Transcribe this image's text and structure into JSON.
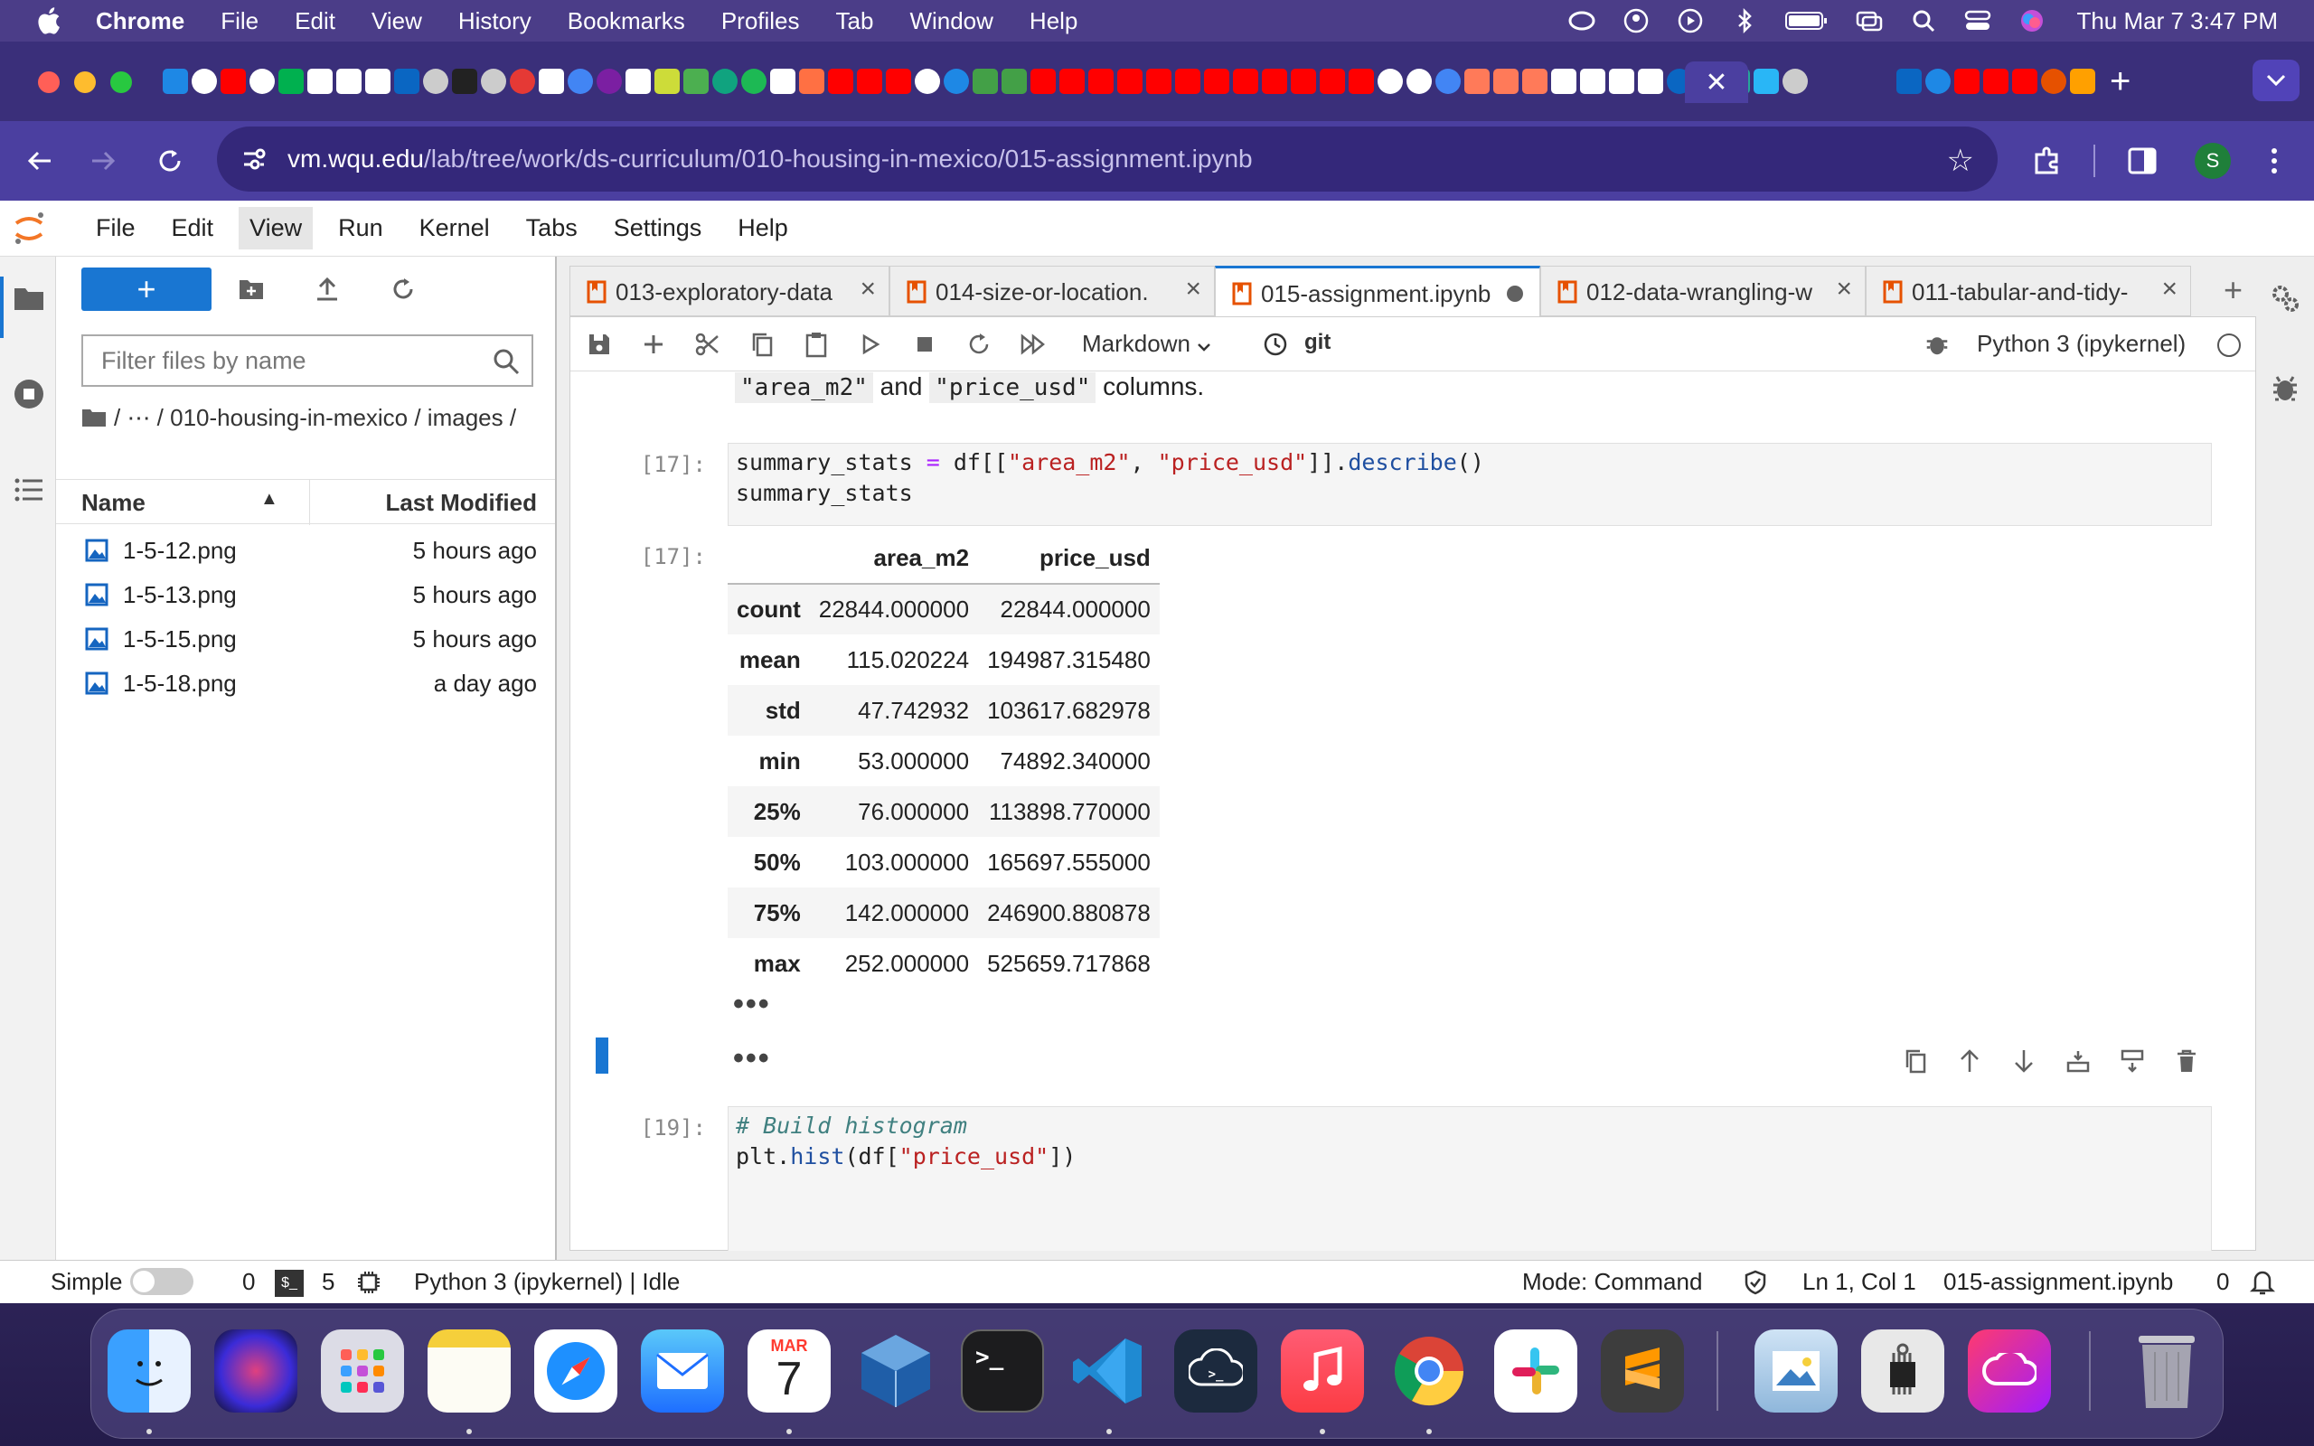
{
  "macos_menubar": {
    "app_name": "Chrome",
    "items": [
      "File",
      "Edit",
      "View",
      "History",
      "Bookmarks",
      "Profiles",
      "Tab",
      "Window",
      "Help"
    ],
    "clock": "Thu Mar 7  3:47 PM",
    "status_icons": [
      "creative-cloud-icon",
      "user-circle-icon",
      "play-circle-icon",
      "bluetooth-icon",
      "battery-icon",
      "screen-mirror-icon",
      "search-icon",
      "control-center-icon",
      "siri-icon"
    ]
  },
  "chrome": {
    "active_tab_close": "✕",
    "new_tab": "+",
    "url_host": "vm.wqu.edu",
    "url_path": "/lab/tree/work/ds-curriculum/010-housing-in-mexico/015-assignment.ipynb",
    "profile_initial": "S"
  },
  "jupyter_menu": [
    "File",
    "Edit",
    "View",
    "Run",
    "Kernel",
    "Tabs",
    "Settings",
    "Help"
  ],
  "filebrowser": {
    "new_button": "+",
    "filter_placeholder": "Filter files by name",
    "breadcrumb": "/ ⋯ / 010-housing-in-mexico / images /",
    "col_name": "Name",
    "col_modified": "Last Modified",
    "files": [
      {
        "name": "1-5-12.png",
        "modified": "5 hours ago"
      },
      {
        "name": "1-5-13.png",
        "modified": "5 hours ago"
      },
      {
        "name": "1-5-15.png",
        "modified": "5 hours ago"
      },
      {
        "name": "1-5-18.png",
        "modified": "a day ago"
      }
    ]
  },
  "doc_tabs": [
    {
      "label": "013-exploratory-data",
      "active": false
    },
    {
      "label": "014-size-or-location.",
      "active": false
    },
    {
      "label": "015-assignment.ipynb",
      "active": true
    },
    {
      "label": "012-data-wrangling-w",
      "active": false
    },
    {
      "label": "011-tabular-and-tidy-",
      "active": false
    }
  ],
  "notebook_toolbar": {
    "cell_type": "Markdown",
    "git": "git",
    "kernel": "Python 3 (ipykernel)"
  },
  "cells": {
    "markdown_tail": {
      "code1": "\"area_m2\"",
      "and": "and",
      "code2": "\"price_usd\"",
      "rest": "columns."
    },
    "cell17_prompt": "[17]:",
    "cell17_code": {
      "line1_var": "summary_stats",
      "line1_eq": " = ",
      "line1_df": "df[[",
      "line1_s1": "\"area_m2\"",
      "line1_comma": ", ",
      "line1_s2": "\"price_usd\"",
      "line1_close": "]].",
      "line1_fn": "describe",
      "line1_end": "()",
      "line2": "summary_stats"
    },
    "out17_prompt": "[17]:",
    "table_header": [
      "",
      "area_m2",
      "price_usd"
    ],
    "table_rows": [
      [
        "count",
        "22844.000000",
        "22844.000000"
      ],
      [
        "mean",
        "115.020224",
        "194987.315480"
      ],
      [
        "std",
        "47.742932",
        "103617.682978"
      ],
      [
        "min",
        "53.000000",
        "74892.340000"
      ],
      [
        "25%",
        "76.000000",
        "113898.770000"
      ],
      [
        "50%",
        "103.000000",
        "165697.555000"
      ],
      [
        "75%",
        "142.000000",
        "246900.880878"
      ],
      [
        "max",
        "252.000000",
        "525659.717868"
      ]
    ],
    "ellipsis": "•••",
    "cell19_prompt": "[19]:",
    "cell19_comment": "# Build histogram",
    "cell19_pre": "plt.",
    "cell19_fn": "hist",
    "cell19_mid": "(df[",
    "cell19_str": "\"price_usd\"",
    "cell19_end": "])"
  },
  "statusbar": {
    "simple": "Simple",
    "count1": "0",
    "count2": "5",
    "kernel_status": "Python 3 (ipykernel) | Idle",
    "mode": "Mode: Command",
    "position": "Ln 1, Col 1",
    "filename": "015-assignment.ipynb",
    "notifications": "0"
  },
  "dock": {
    "calendar_month": "MAR",
    "calendar_day": "7",
    "apps": [
      "finder-icon",
      "siri-icon",
      "launchpad-icon",
      "notes-icon",
      "safari-icon",
      "mail-icon",
      "calendar-icon",
      "virtualbox-icon",
      "terminal-icon",
      "vscode-icon",
      "chatgpt-icon",
      "music-icon",
      "chrome-icon",
      "slack-icon",
      "sublime-icon",
      "preview-icon",
      "system-info-icon",
      "creative-cloud-icon",
      "trash-icon"
    ]
  },
  "colors": {
    "jupyter_blue": "#1976d2",
    "chrome_toolbar": "#4b3fa0",
    "notebook_tab_icon": "#e65100"
  }
}
